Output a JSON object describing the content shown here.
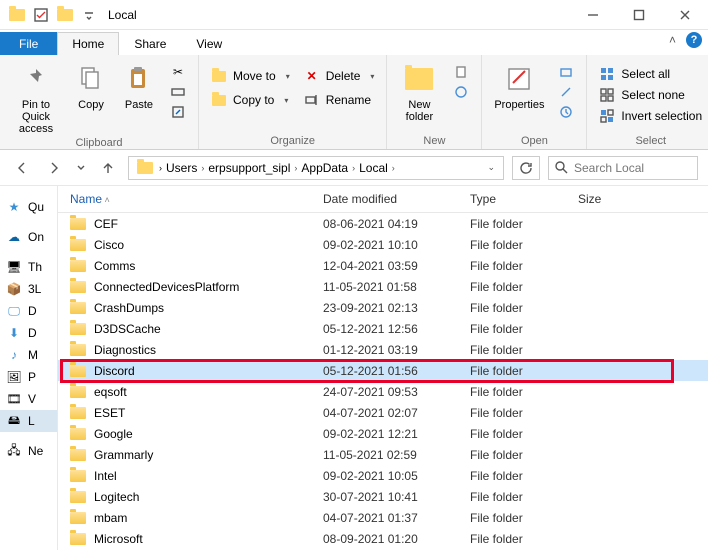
{
  "titlebar": {
    "title": "Local"
  },
  "tabs": {
    "file": "File",
    "home": "Home",
    "share": "Share",
    "view": "View"
  },
  "ribbon": {
    "clipboard": {
      "label": "Clipboard",
      "pin": "Pin to Quick access",
      "copy": "Copy",
      "paste": "Paste"
    },
    "organize": {
      "label": "Organize",
      "moveto": "Move to",
      "copyto": "Copy to",
      "delete": "Delete",
      "rename": "Rename"
    },
    "new": {
      "label": "New",
      "newfolder": "New folder"
    },
    "open": {
      "label": "Open",
      "properties": "Properties"
    },
    "select": {
      "label": "Select",
      "all": "Select all",
      "none": "Select none",
      "invert": "Invert selection"
    }
  },
  "breadcrumb": [
    "Users",
    "erpsupport_sipl",
    "AppData",
    "Local"
  ],
  "search": {
    "placeholder": "Search Local"
  },
  "columns": {
    "name": "Name",
    "date": "Date modified",
    "type": "Type",
    "size": "Size"
  },
  "nav": [
    "Qu",
    "On",
    "Th",
    "3L",
    "D",
    "D",
    "M",
    "P",
    "V",
    "L",
    "Ne"
  ],
  "rows": [
    {
      "name": "CEF",
      "date": "08-06-2021 04:19",
      "type": "File folder"
    },
    {
      "name": "Cisco",
      "date": "09-02-2021 10:10",
      "type": "File folder"
    },
    {
      "name": "Comms",
      "date": "12-04-2021 03:59",
      "type": "File folder"
    },
    {
      "name": "ConnectedDevicesPlatform",
      "date": "11-05-2021 01:58",
      "type": "File folder"
    },
    {
      "name": "CrashDumps",
      "date": "23-09-2021 02:13",
      "type": "File folder"
    },
    {
      "name": "D3DSCache",
      "date": "05-12-2021 12:56",
      "type": "File folder"
    },
    {
      "name": "Diagnostics",
      "date": "01-12-2021 03:19",
      "type": "File folder"
    },
    {
      "name": "Discord",
      "date": "05-12-2021 01:56",
      "type": "File folder",
      "selected": true,
      "highlighted": true
    },
    {
      "name": "eqsoft",
      "date": "24-07-2021 09:53",
      "type": "File folder"
    },
    {
      "name": "ESET",
      "date": "04-07-2021 02:07",
      "type": "File folder"
    },
    {
      "name": "Google",
      "date": "09-02-2021 12:21",
      "type": "File folder"
    },
    {
      "name": "Grammarly",
      "date": "11-05-2021 02:59",
      "type": "File folder"
    },
    {
      "name": "Intel",
      "date": "09-02-2021 10:05",
      "type": "File folder"
    },
    {
      "name": "Logitech",
      "date": "30-07-2021 10:41",
      "type": "File folder"
    },
    {
      "name": "mbam",
      "date": "04-07-2021 01:37",
      "type": "File folder"
    },
    {
      "name": "Microsoft",
      "date": "08-09-2021 01:20",
      "type": "File folder"
    }
  ]
}
